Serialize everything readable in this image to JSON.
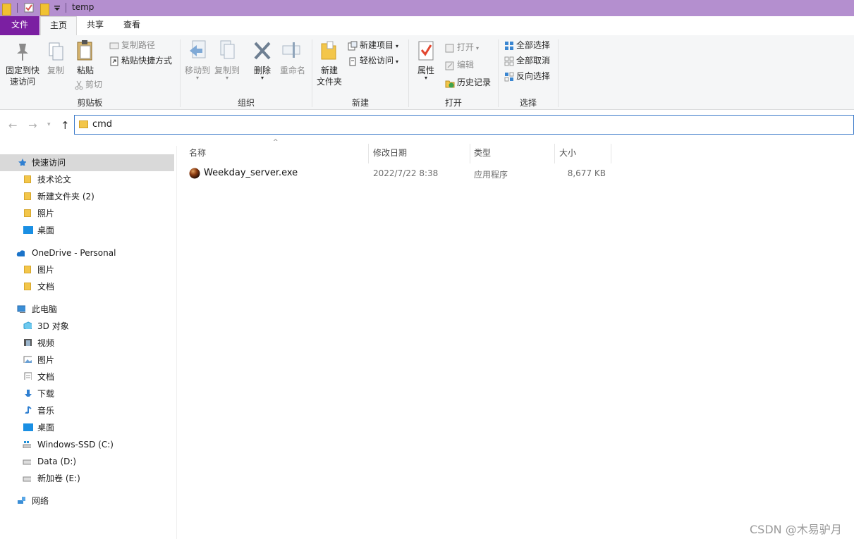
{
  "window": {
    "title": "temp"
  },
  "ribbon_tabs": {
    "file": "文件",
    "home": "主页",
    "share": "共享",
    "view": "查看"
  },
  "clipboard": {
    "pin": "固定到快\n速访问",
    "copy": "复制",
    "paste": "粘贴",
    "copy_path": "复制路径",
    "paste_shortcut": "粘贴快捷方式",
    "cut": "剪切",
    "group": "剪贴板"
  },
  "organize": {
    "move_to": "移动到",
    "copy_to": "复制到",
    "delete": "删除",
    "rename": "重命名",
    "group": "组织"
  },
  "new": {
    "new_folder": "新建\n文件夹",
    "new_item": "新建项目",
    "easy_access": "轻松访问",
    "group": "新建"
  },
  "open": {
    "properties": "属性",
    "open": "打开",
    "edit": "编辑",
    "history": "历史记录",
    "group": "打开"
  },
  "select": {
    "select_all": "全部选择",
    "select_none": "全部取消",
    "invert": "反向选择",
    "group": "选择"
  },
  "address": {
    "path": "cmd"
  },
  "nav": {
    "quick_access": "快速访问",
    "quick_items": [
      "技术论文",
      "新建文件夹 (2)",
      "照片",
      "桌面"
    ],
    "onedrive": "OneDrive - Personal",
    "onedrive_items": [
      "图片",
      "文档"
    ],
    "this_pc": "此电脑",
    "pc_items": [
      "3D 对象",
      "视频",
      "图片",
      "文档",
      "下载",
      "音乐",
      "桌面",
      "Windows-SSD (C:)",
      "Data (D:)",
      "新加卷 (E:)"
    ],
    "network": "网络"
  },
  "columns": {
    "name": "名称",
    "date": "修改日期",
    "type": "类型",
    "size": "大小"
  },
  "files": [
    {
      "name": "Weekday_server.exe",
      "date": "2022/7/22 8:38",
      "type": "应用程序",
      "size": "8,677 KB"
    }
  ],
  "watermark": "CSDN @木易驴月"
}
